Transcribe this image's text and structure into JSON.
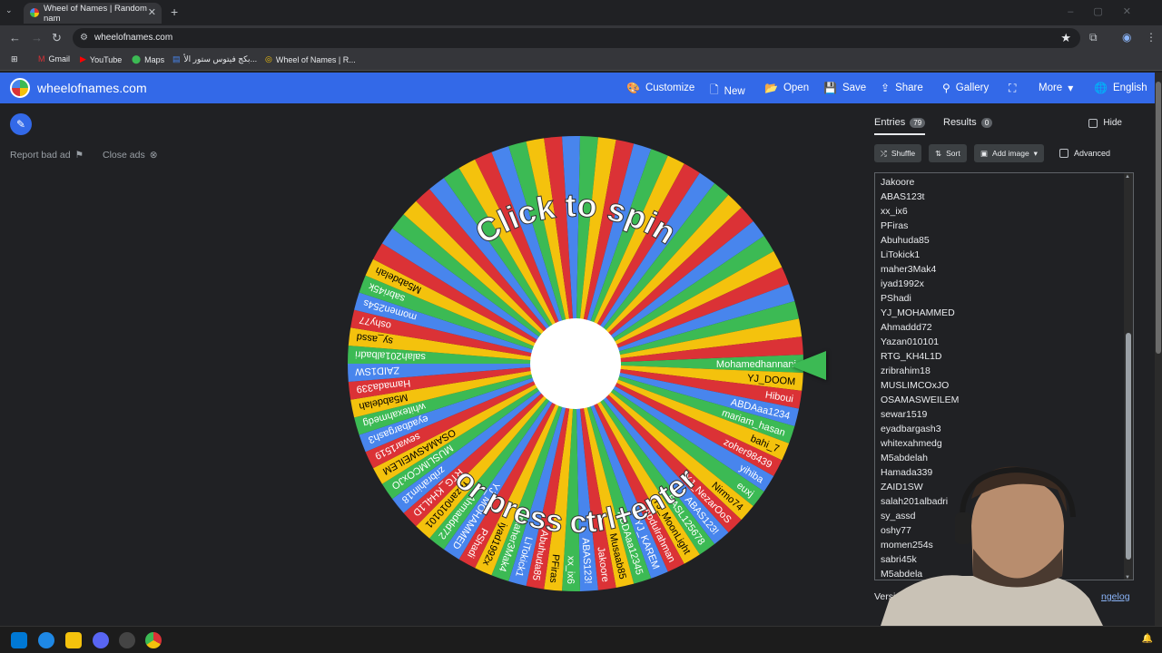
{
  "browser": {
    "tab_title": "Wheel of Names | Random nam",
    "url": "wheelofnames.com",
    "bookmarks": [
      "Gmail",
      "YouTube",
      "Maps",
      "بكج فيتوس ستور الأ...",
      "Wheel of Names | R..."
    ]
  },
  "app": {
    "brand": "wheelofnames.com",
    "menu": {
      "customize": "Customize",
      "new": "New",
      "open": "Open",
      "save": "Save",
      "share": "Share",
      "gallery": "Gallery",
      "more": "More",
      "language": "English"
    },
    "ad_links": {
      "report": "Report bad ad",
      "close": "Close ads"
    }
  },
  "wheel": {
    "center_text_top": "Click to spin",
    "center_text_bottom": "or press ctrl+enter",
    "colors": [
      "#3cba54",
      "#f4c20d",
      "#db3236",
      "#4885ed"
    ],
    "visible_labels": [
      "Mohamedhannani",
      "YJ_DOOM",
      "Hiboui",
      "ABDAaa1234",
      "mariam_hasan",
      "bahi_7",
      "zoher98439",
      "yihiba",
      "euxj",
      "Nirmo74",
      "YJ_NezarOoS",
      "ABAS123!",
      "BASL125678",
      "YJ_MoonLight",
      "Abdulrahman",
      "YJ_KAREM",
      "ABDAaa12345",
      "Musaab85",
      "Jakoore",
      "ABAS123!",
      "xx_ix6",
      "PFiras",
      "Abuhuda85",
      "LiTokick1",
      "maher3Mak4",
      "iyad1992x",
      "PShadi",
      "YJ_MOHAMMED",
      "Ahmaddd72",
      "Yazan010101",
      "RTG_KH4L1D",
      "zribrahim18",
      "MUSLIMCOxJO",
      "OSAMASWEILEM",
      "sewar1519",
      "eyadbargash3",
      "whitexahmedg",
      "M5abdelah",
      "Hamada339",
      "ZAID1SW",
      "salah201albadri",
      "sy_assd",
      "oshy77",
      "momen254s",
      "sabri45k",
      "M5abdelah"
    ]
  },
  "panel": {
    "tab_entries": "Entries",
    "entries_count": "79",
    "tab_results": "Results",
    "results_count": "0",
    "hide": "Hide",
    "shuffle": "Shuffle",
    "sort": "Sort",
    "add_image": "Add image",
    "advanced": "Advanced",
    "entries": [
      "Jakoore",
      "ABAS123t",
      "xx_ix6",
      "PFiras",
      "Abuhuda85",
      "LiTokick1",
      "maher3Mak4",
      "iyad1992x",
      "PShadi",
      "YJ_MOHAMMED",
      "Ahmaddd72",
      "Yazan010101",
      "RTG_KH4L1D",
      "zribrahim18",
      "MUSLIMCOxJO",
      "OSAMASWEILEM",
      "sewar1519",
      "eyadbargash3",
      "whitexahmedg",
      "M5abdelah",
      "Hamada339",
      "ZAID1SW",
      "salah201albadri",
      "sy_assd",
      "oshy77",
      "momen254s",
      "sabri45k",
      "M5abdela"
    ],
    "version": "Version",
    "changelog": "ngelog"
  }
}
